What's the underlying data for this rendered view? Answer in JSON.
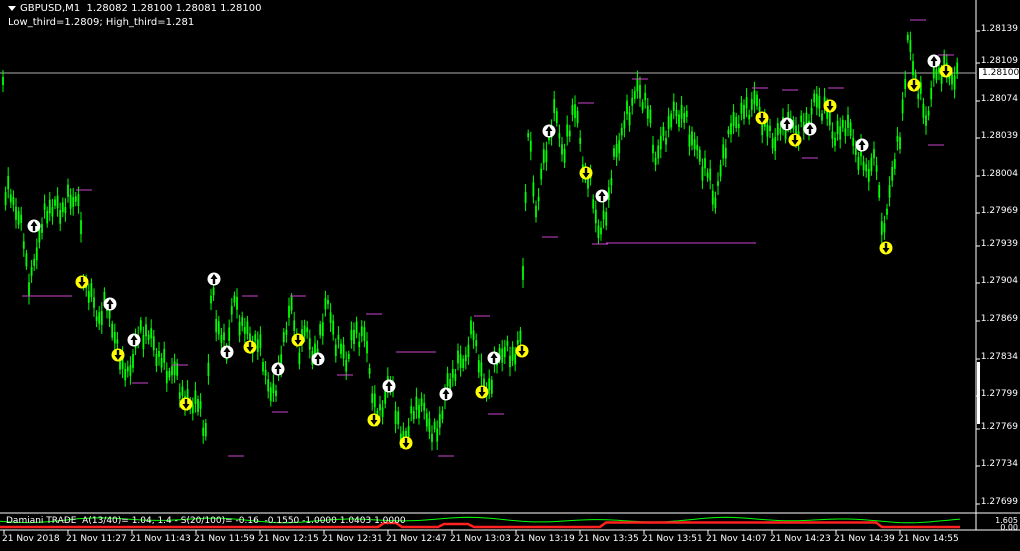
{
  "header": {
    "symbol_line": "GBPUSD,M1  1.28082 1.28100 1.28081 1.28100",
    "levels_line": "Low_third=1.2809; High_third=1.281"
  },
  "price_axis": [
    "1.28139",
    "1.28109",
    "1.28074",
    "1.28039",
    "1.28004",
    "1.27969",
    "1.27939",
    "1.27904",
    "1.27869",
    "1.27834",
    "1.27799",
    "1.27769",
    "1.27734",
    "1.27699"
  ],
  "current_price": "1.28100",
  "indicator": {
    "label": "Damiani TRADE  A(13/40)= 1.04, 1.4 - S(20/100)= -0.16  -0.1550 -1.0000 1.0403 1.0000",
    "axis_top": "1.605",
    "axis_bottom": "0.00"
  },
  "time_axis": [
    "21 Nov 2018",
    "21 Nov 11:27",
    "21 Nov 11:43",
    "21 Nov 11:59",
    "21 Nov 12:15",
    "21 Nov 12:31",
    "21 Nov 12:47",
    "21 Nov 13:03",
    "21 Nov 13:19",
    "21 Nov 13:35",
    "21 Nov 13:51",
    "21 Nov 14:07",
    "21 Nov 14:23",
    "21 Nov 14:39",
    "21 Nov 14:55"
  ],
  "colors": {
    "candle": "#00ff00",
    "ask_line": "#b0b0b0",
    "signal_up": "#ffffff",
    "signal_down": "#ffff00",
    "level_marks": "#cc44cc",
    "indicator_red": "#ff2020"
  }
}
